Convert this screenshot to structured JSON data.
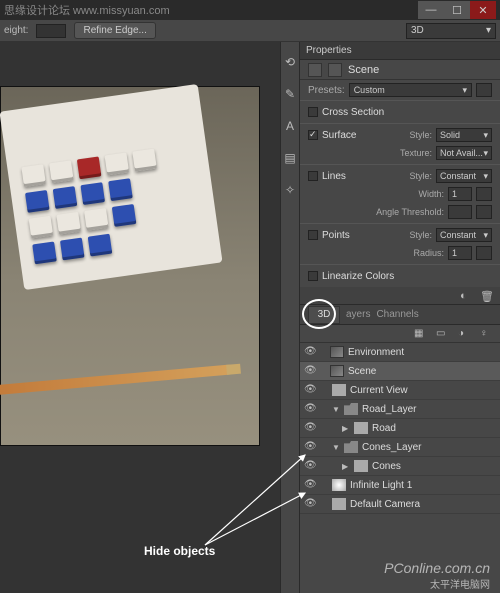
{
  "titlebar": {
    "text": "思缘设计论坛  www.missyuan.com"
  },
  "window_controls": {
    "minimize": "—",
    "maximize": "☐",
    "close": "✕"
  },
  "top_options": {
    "height_label": "eight:",
    "refine_edge_label": "Refine Edge...",
    "mode_dropdown": "3D"
  },
  "dock": [
    "⟲",
    "✎",
    "A",
    "▤",
    "✧"
  ],
  "properties": {
    "panel_title": "Properties",
    "scene_label": "Scene",
    "presets_label": "Presets:",
    "presets_value": "Custom",
    "sections": {
      "cross_section": {
        "label": "Cross Section",
        "checked": false
      },
      "surface": {
        "label": "Surface",
        "checked": true,
        "style_label": "Style:",
        "style_value": "Solid",
        "texture_label": "Texture:",
        "texture_value": "Not Avail..."
      },
      "lines": {
        "label": "Lines",
        "checked": false,
        "style_label": "Style:",
        "style_value": "Constant",
        "width_label": "Width:",
        "width_value": "1",
        "angle_label": "Angle Threshold:"
      },
      "points": {
        "label": "Points",
        "checked": false,
        "style_label": "Style:",
        "style_value": "Constant",
        "radius_label": "Radius:",
        "radius_value": "1"
      },
      "linearize": {
        "label": "Linearize Colors",
        "checked": false
      }
    }
  },
  "three_d_panel": {
    "tab_3d": "3D",
    "tab_layers": "ayers",
    "tab_channels": "Channels",
    "items": [
      {
        "name": "Environment",
        "icon": "scene",
        "indent": 1
      },
      {
        "name": "Scene",
        "icon": "scene",
        "indent": 1,
        "selected": true
      },
      {
        "name": "Current View",
        "icon": "cam",
        "indent": 2
      },
      {
        "name": "Road_Layer",
        "icon": "folder",
        "indent": 2,
        "twist": "▼"
      },
      {
        "name": "Road",
        "icon": "mesh",
        "indent": 3,
        "twist": "▶"
      },
      {
        "name": "Cones_Layer",
        "icon": "folder",
        "indent": 2,
        "twist": "▼"
      },
      {
        "name": "Cones",
        "icon": "mesh",
        "indent": 3,
        "twist": "▶"
      },
      {
        "name": "Infinite Light 1",
        "icon": "light",
        "indent": 2
      },
      {
        "name": "Default Camera",
        "icon": "cam",
        "indent": 2
      }
    ]
  },
  "annotation": {
    "label": "Hide objects"
  },
  "watermark_bottom": {
    "line1": "PConline.com.cn",
    "line2": "太平洋电脑网"
  }
}
